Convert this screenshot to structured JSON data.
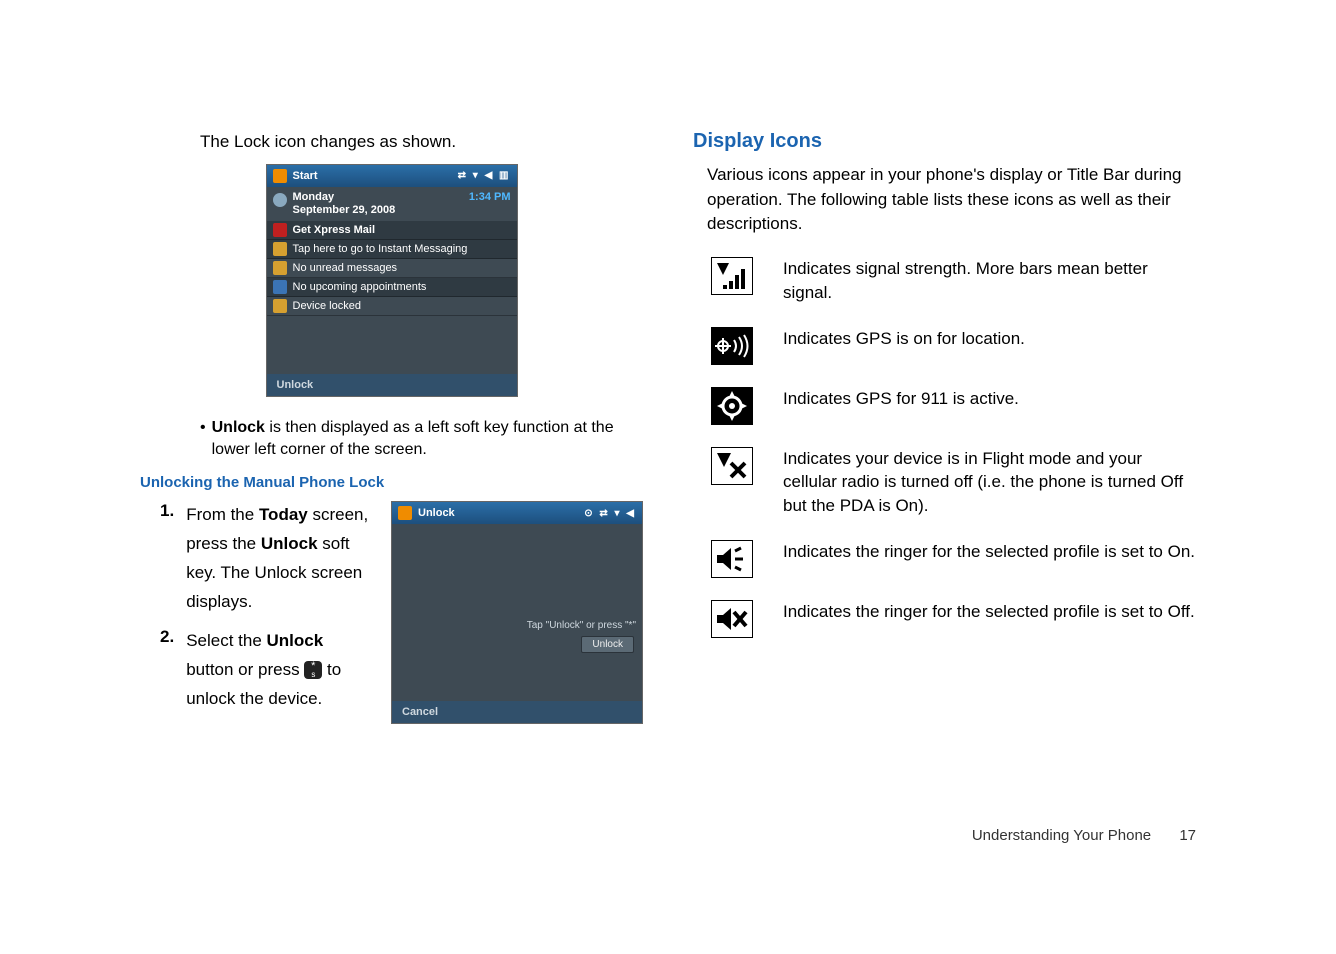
{
  "leftColumn": {
    "introText": "The Lock icon changes as shown.",
    "screenshot1": {
      "titleBar": {
        "startLabel": "Start"
      },
      "dateBlock": {
        "day": "Monday",
        "date": "September 29, 2008",
        "time": "1:34 PM"
      },
      "rows": {
        "xpressMail": "Get Xpress Mail",
        "im": "Tap here to go to Instant Messaging",
        "unread": "No unread messages",
        "appointments": "No upcoming appointments",
        "locked": "Device locked"
      },
      "bottomBar": "Unlock"
    },
    "bulletText": {
      "bold": "Unlock",
      "rest": " is then displayed as a left soft key function at the lower left corner of the screen."
    },
    "sectionTitle": "Unlocking the Manual Phone Lock",
    "step1": {
      "num": "1.",
      "pre": "From the ",
      "b1": "Today",
      "mid1": " screen, press the ",
      "b2": "Unlock",
      "post": " soft key. The Unlock screen displays."
    },
    "step2": {
      "num": "2.",
      "pre": "Select the ",
      "b1": "Unlock",
      "mid": " button or press ",
      "post": " to unlock the device."
    },
    "screenshot2": {
      "titleBar": "Unlock",
      "hint": "Tap \"Unlock\" or press \"*\"",
      "unlockBtn": "Unlock",
      "bottomBar": "Cancel"
    }
  },
  "rightColumn": {
    "title": "Display Icons",
    "intro": "Various icons appear in your phone's display or Title Bar during operation. The following table lists these icons as well as their descriptions.",
    "icons": [
      {
        "desc": "Indicates signal strength. More bars mean better signal."
      },
      {
        "desc": "Indicates GPS is on for location."
      },
      {
        "desc": "Indicates GPS for 911 is active."
      },
      {
        "desc": "Indicates your device is in Flight mode and your cellular radio is turned off (i.e. the phone is turned Off but the PDA is On)."
      },
      {
        "desc": "Indicates the ringer for the selected profile is set to On."
      },
      {
        "desc": "Indicates the ringer for the selected profile is set to Off."
      }
    ]
  },
  "footer": {
    "section": "Understanding Your Phone",
    "page": "17"
  }
}
